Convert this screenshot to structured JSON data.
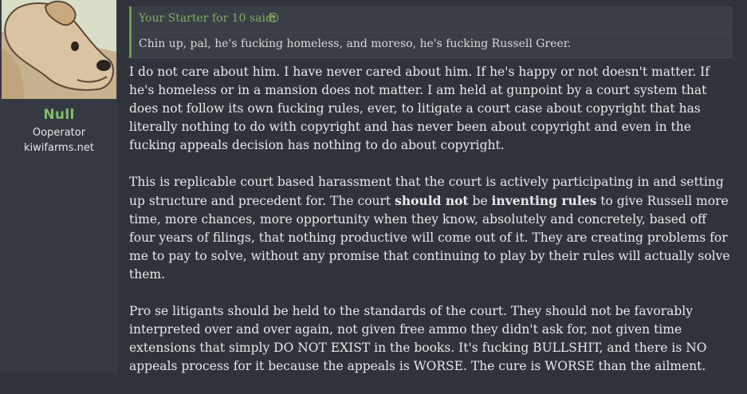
{
  "user": {
    "name": "Null",
    "title": "Ooperator",
    "banner": "kiwifarms.net"
  },
  "quote": {
    "author": "Your Starter for 10 said:",
    "text": "Chin up, pal, he's fucking homeless, and moreso, he's fucking Russell Greer."
  },
  "post": {
    "p1": "I do not care about him. I have never cared about him. If he's happy or not doesn't matter. If he's homeless or in a mansion does not matter. I am held at gunpoint by a court system that does not follow its own fucking rules, ever, to litigate a court case about copyright that has literally nothing to do with copyright and has never been about copyright and even in the fucking appeals decision has nothing to do about copyright.",
    "p2a": "This is replicable court based harassment that the court is actively participating in and setting up structure and precedent for. The court ",
    "p2b": "should not",
    "p2c": " be ",
    "p2d": "inventing rules",
    "p2e": " to give Russell more time, more chances, more opportunity when they know, absolutely and concretely, based off four years of filings, that nothing productive will come out of it. They are creating problems for me to pay to solve, without any promise that continuing to play by their rules will actually solve them.",
    "p3": "Pro se litigants should be held to the standards of the court. They should not be favorably interpreted over and over again, not given free ammo they didn't ask for, not given time extensions that simply DO NOT EXIST in the books. It's fucking BULLSHIT, and there is NO appeals process for it because the appeals is WORSE. The cure is WORSE than the ailment."
  },
  "colors": {
    "accent_green": "#7fbf6a",
    "background": "#2f333b"
  },
  "icons": {
    "avatar": "dog-avatar",
    "quote_jump": "arrow-up-circle-icon"
  }
}
